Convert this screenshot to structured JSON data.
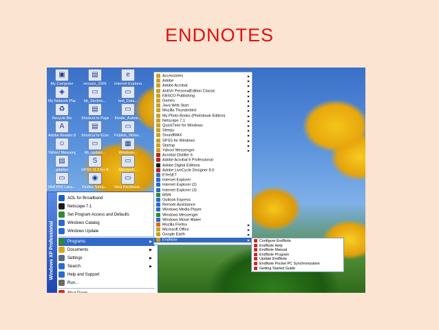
{
  "slide": {
    "title": "ENDNOTES"
  },
  "desktop_icons": [
    {
      "label": "My Computer",
      "icon": "computer-icon"
    },
    {
      "label": "rensani_2006",
      "icon": "folder-icon"
    },
    {
      "label": "Internet Explorer",
      "icon": "ie-icon"
    },
    {
      "label": "My Network Places",
      "icon": "network-icon"
    },
    {
      "label": "bb_Section...",
      "icon": "document-icon"
    },
    {
      "label": "test_Data...",
      "icon": "document-icon"
    },
    {
      "label": "Recycle Bin",
      "icon": "recycle-bin-icon"
    },
    {
      "label": "Shortcut to Papers",
      "icon": "folder-icon"
    },
    {
      "label": "Kindle_Author...",
      "icon": "document-icon"
    },
    {
      "label": "Adobe Reader 8",
      "icon": "adobe-icon"
    },
    {
      "label": "Shortcut to Kcsoftware",
      "icon": "folder-icon"
    },
    {
      "label": "Publish_Writer...",
      "icon": "document-icon"
    },
    {
      "label": "Yahoo! Messenger",
      "icon": "messenger-icon"
    },
    {
      "label": "bb_update...",
      "icon": "document-icon"
    },
    {
      "label": "Windows...",
      "icon": "window-icon"
    },
    {
      "label": "gdallen",
      "icon": "folder-icon"
    },
    {
      "label": "SPSS 11.5 for Windows",
      "icon": "spss-icon"
    },
    {
      "label": "Microsoft...",
      "icon": "document-icon"
    },
    {
      "label": "Mell P52 Lana...",
      "icon": "document-icon"
    },
    {
      "label": "Firefox Setup...",
      "icon": "firefox-icon"
    },
    {
      "label": "Vera Facebook...",
      "icon": "document-icon"
    }
  ],
  "start_menu": {
    "brand": "Windows XP Professional",
    "pinned": [
      {
        "label": "AOL for Broadband",
        "icon": "aol-icon",
        "color": "#1b5fc6"
      },
      {
        "label": "Netscape 7.1",
        "icon": "netscape-icon",
        "color": "#1a1a1a"
      },
      {
        "label": "Set Program Access and Defaults",
        "icon": "program-access-icon",
        "color": "#2f8a2f"
      },
      {
        "label": "Windows Catalog",
        "icon": "catalog-icon",
        "color": "#2b6ad0"
      },
      {
        "label": "Windows Update",
        "icon": "windows-update-icon",
        "color": "#2b6ad0"
      }
    ],
    "main": [
      {
        "label": "Programs",
        "icon": "programs-icon",
        "color": "#2f8a2f",
        "arrow": "▶"
      },
      {
        "label": "Documents",
        "icon": "documents-icon",
        "color": "#d7a91f",
        "arrow": "▶"
      },
      {
        "label": "Settings",
        "icon": "settings-icon",
        "color": "#5b6b87",
        "arrow": "▶"
      },
      {
        "label": "Search",
        "icon": "search-icon",
        "color": "#2b6ad0",
        "arrow": "▶"
      },
      {
        "label": "Help and Support",
        "icon": "help-icon",
        "color": "#2b6ad0",
        "arrow": ""
      },
      {
        "label": "Run...",
        "icon": "run-icon",
        "color": "#6a6a6a",
        "arrow": ""
      }
    ],
    "shutdown": {
      "label": "Shut Down...",
      "icon": "shutdown-icon",
      "color": "#d22b1f"
    }
  },
  "programs_menu": {
    "items": [
      {
        "label": "Accessories",
        "color": "#c8a02a",
        "arrow": "▶"
      },
      {
        "label": "Adobe",
        "color": "#c8a02a",
        "arrow": "▶"
      },
      {
        "label": "Adobe Acrobat",
        "color": "#c8a02a",
        "arrow": "▶"
      },
      {
        "label": "AntiVir PersonalEdition Classic",
        "color": "#c8a02a",
        "arrow": "▶"
      },
      {
        "label": "EBSCO Publishing",
        "color": "#c8a02a",
        "arrow": "▶"
      },
      {
        "label": "Games",
        "color": "#c8a02a",
        "arrow": "▶"
      },
      {
        "label": "Java Web Start",
        "color": "#c8a02a",
        "arrow": "▶"
      },
      {
        "label": "Mozilla Thunderbird",
        "color": "#c8a02a",
        "arrow": "▶"
      },
      {
        "label": "My Photo Books (Photobook Edition)",
        "color": "#c8a02a",
        "arrow": "▶"
      },
      {
        "label": "Netscape 7.1",
        "color": "#c8a02a",
        "arrow": "▶"
      },
      {
        "label": "QuickTime for Windows",
        "color": "#c8a02a",
        "arrow": "▶"
      },
      {
        "label": "Sleepy",
        "color": "#c8a02a",
        "arrow": "▶"
      },
      {
        "label": "SoundMAX",
        "color": "#c8a02a",
        "arrow": "▶"
      },
      {
        "label": "SPSS for Windows",
        "color": "#c8a02a",
        "arrow": "▶"
      },
      {
        "label": "Startup",
        "color": "#c8a02a",
        "arrow": "▶"
      },
      {
        "label": "Yahoo! Messenger",
        "color": "#c8a02a",
        "arrow": "▶"
      },
      {
        "label": "Acrobat Distiller 6",
        "color": "#b8261f",
        "arrow": ""
      },
      {
        "label": "Adobe Acrobat 6 Professional",
        "color": "#b8261f",
        "arrow": ""
      },
      {
        "label": "Adobe Digital Editions",
        "color": "#1a1a1a",
        "arrow": ""
      },
      {
        "label": "Adobe LiveCycle Designer 8.0",
        "color": "#b8261f",
        "arrow": ""
      },
      {
        "label": "EYeSET",
        "color": "#3c6bc2",
        "arrow": ""
      },
      {
        "label": "Internet Explorer",
        "color": "#2b6ad0",
        "arrow": ""
      },
      {
        "label": "Internet Explorer (2)",
        "color": "#2b6ad0",
        "arrow": ""
      },
      {
        "label": "Internet Explorer (3)",
        "color": "#2b6ad0",
        "arrow": ""
      },
      {
        "label": "MSN",
        "color": "#2f8a2f",
        "arrow": ""
      },
      {
        "label": "Outlook Express",
        "color": "#2b6ad0",
        "arrow": ""
      },
      {
        "label": "Remote Assistance",
        "color": "#2b6ad0",
        "arrow": ""
      },
      {
        "label": "Windows Media Player",
        "color": "#2b6ad0",
        "arrow": ""
      },
      {
        "label": "Windows Messenger",
        "color": "#2f8a2f",
        "arrow": ""
      },
      {
        "label": "Windows Movie Maker",
        "color": "#2b6ad0",
        "arrow": ""
      },
      {
        "label": "Mozilla Firefox",
        "color": "#d86a1c",
        "arrow": "▶"
      },
      {
        "label": "Microsoft Office",
        "color": "#c8a02a",
        "arrow": "▶"
      },
      {
        "label": "Google Earth",
        "color": "#c8a02a",
        "arrow": "▶"
      },
      {
        "label": "EndNote",
        "color": "#c8a02a",
        "arrow": "▶"
      }
    ]
  },
  "endnote_menu": {
    "items": [
      {
        "label": "Configure EndNote"
      },
      {
        "label": "EndNote Help"
      },
      {
        "label": "EndNote Manual"
      },
      {
        "label": "EndNote Program"
      },
      {
        "label": "Update EndNote"
      },
      {
        "label": "EndNote Pocket PC Synchronization"
      },
      {
        "label": "Getting Started Guide"
      }
    ]
  }
}
